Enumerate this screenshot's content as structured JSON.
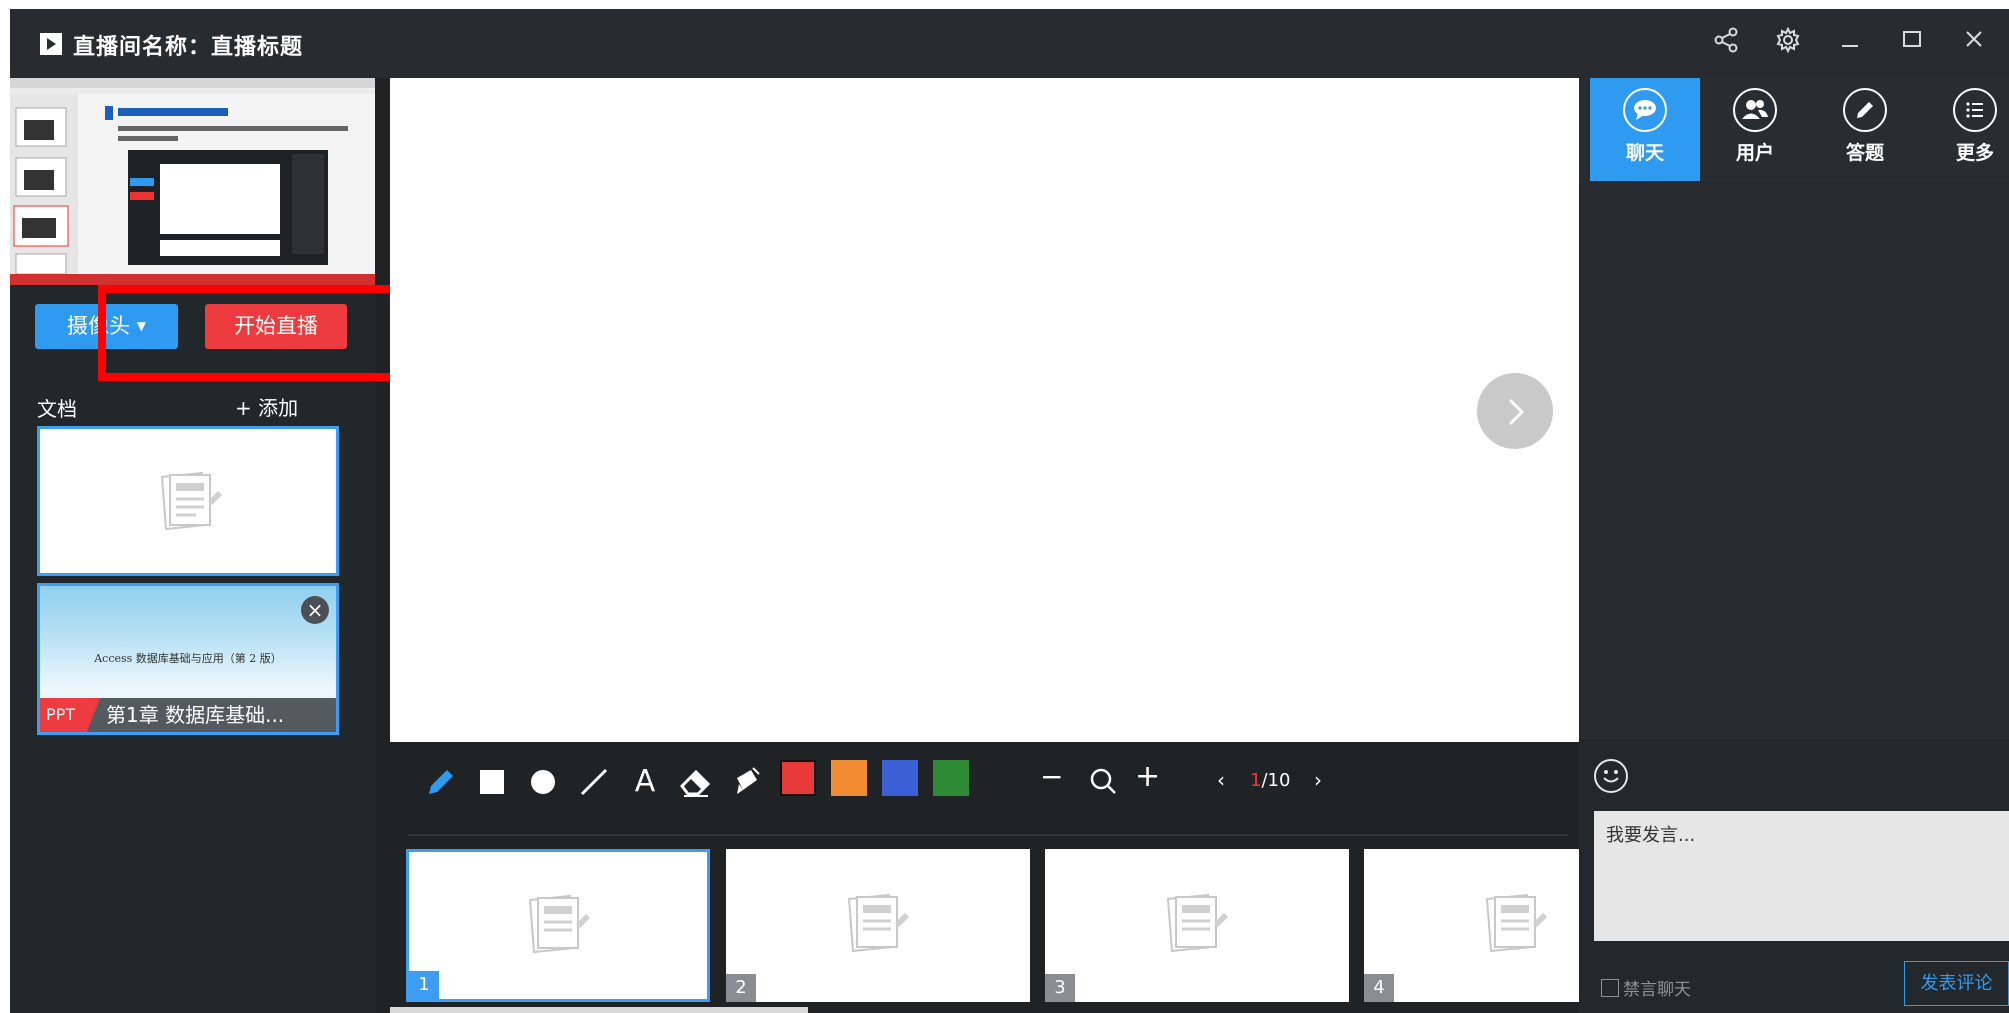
{
  "window": {
    "title": "直播间名称：直播标题",
    "controls": [
      "share-icon",
      "gear-icon",
      "minimize-icon",
      "maximize-icon",
      "close-icon"
    ]
  },
  "left_panel": {
    "camera_button": "摄像头",
    "start_live_button": "开始直播",
    "docs_label": "文档",
    "add_label": "+ 添加",
    "ppt_card": {
      "subtitle": "Access 数据库基础与应用（第 2 版）",
      "badge": "PPT",
      "name": "第1章  数据库基础..."
    }
  },
  "toolbar": {
    "tools": [
      "pen-icon",
      "rectangle-icon",
      "circle-icon",
      "line-icon",
      "text-icon",
      "eraser-icon",
      "clear-icon"
    ],
    "text_tool": "A",
    "colors": [
      "#e93a3a",
      "#f08b32",
      "#3b5fd4",
      "#2e8a34"
    ],
    "zoom_out": "−",
    "zoom_in": "+",
    "current_page": "1",
    "total_pages": "/10"
  },
  "slides": [
    {
      "num": "1",
      "selected": true
    },
    {
      "num": "2",
      "selected": false
    },
    {
      "num": "3",
      "selected": false
    },
    {
      "num": "4",
      "selected": false
    }
  ],
  "right_panel": {
    "tabs": [
      {
        "label": "聊天",
        "icon": "chat-icon",
        "active": true
      },
      {
        "label": "用户",
        "icon": "users-icon",
        "active": false
      },
      {
        "label": "答题",
        "icon": "pencil-icon",
        "active": false
      },
      {
        "label": "更多",
        "icon": "list-icon",
        "active": false
      }
    ],
    "chat_placeholder": "我要发言...",
    "mute_label": "禁言聊天",
    "send_button": "发表评论"
  }
}
